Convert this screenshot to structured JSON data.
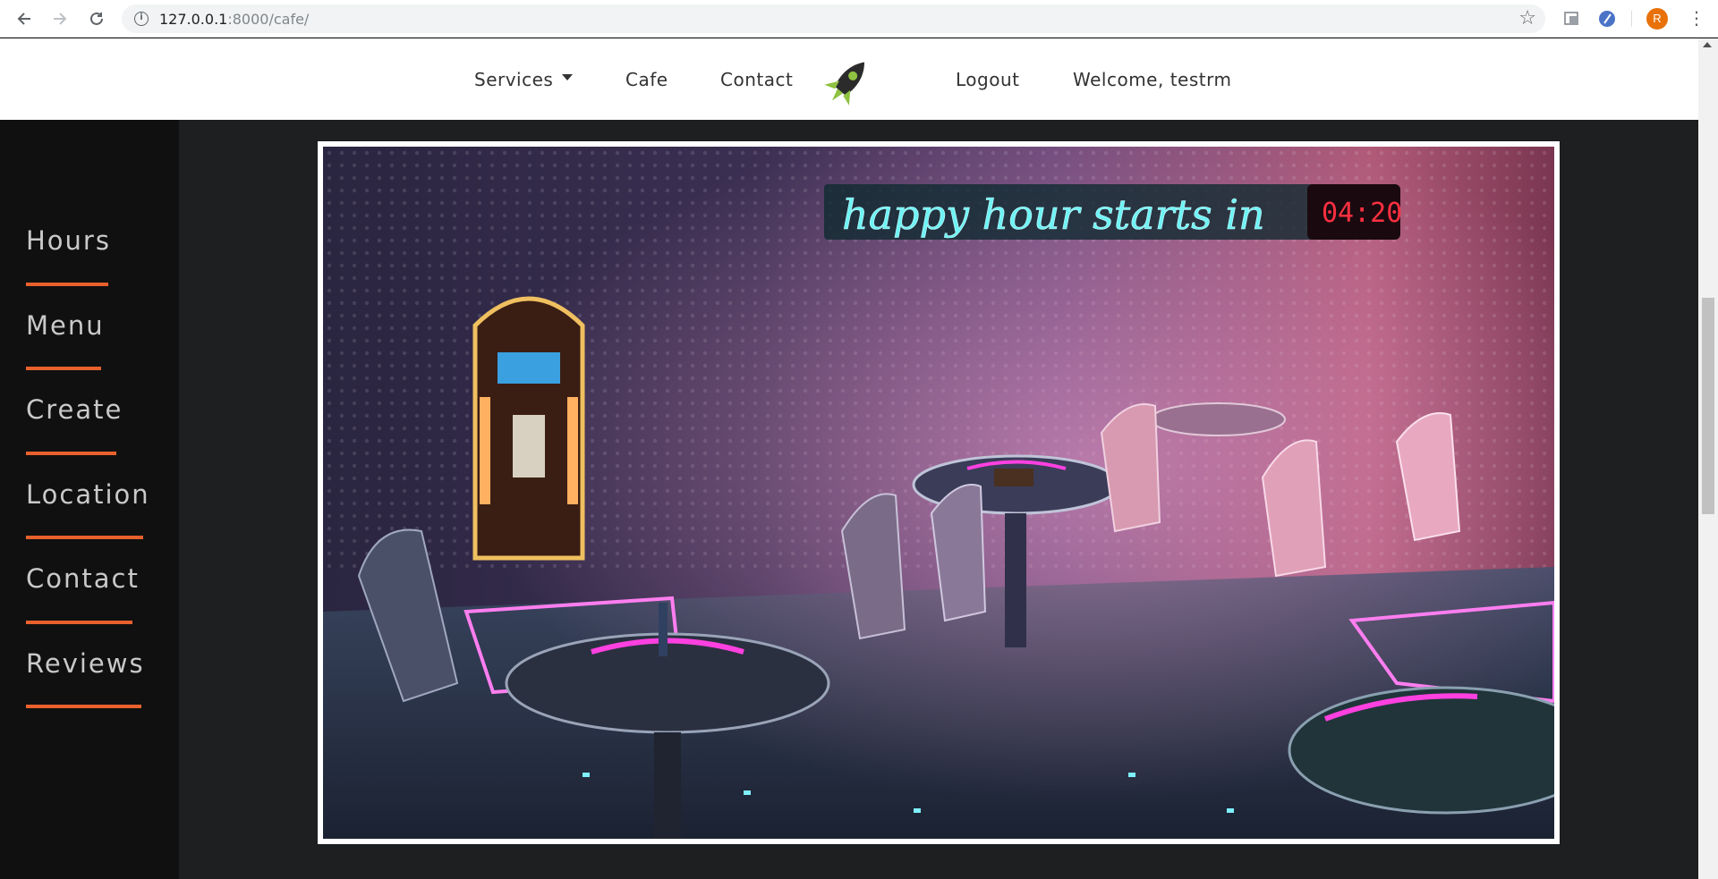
{
  "browser": {
    "url_host": "127.0.0.1",
    "url_path": ":8000/cafe/",
    "avatar_letter": "R"
  },
  "header": {
    "services_label": "Services",
    "cafe_label": "Cafe",
    "contact_label": "Contact",
    "logout_label": "Logout",
    "welcome_text": "Welcome, testrm"
  },
  "sidebar": {
    "items": [
      {
        "label": "Hours"
      },
      {
        "label": "Menu"
      },
      {
        "label": "Create"
      },
      {
        "label": "Location"
      },
      {
        "label": "Contact"
      },
      {
        "label": "Reviews"
      }
    ]
  },
  "hero": {
    "sign_text": "happy hour starts in",
    "clock_text": "04:20"
  },
  "colors": {
    "accent": "#e8612c",
    "sidebar_bg": "#101010",
    "main_bg": "#1e1f20"
  }
}
